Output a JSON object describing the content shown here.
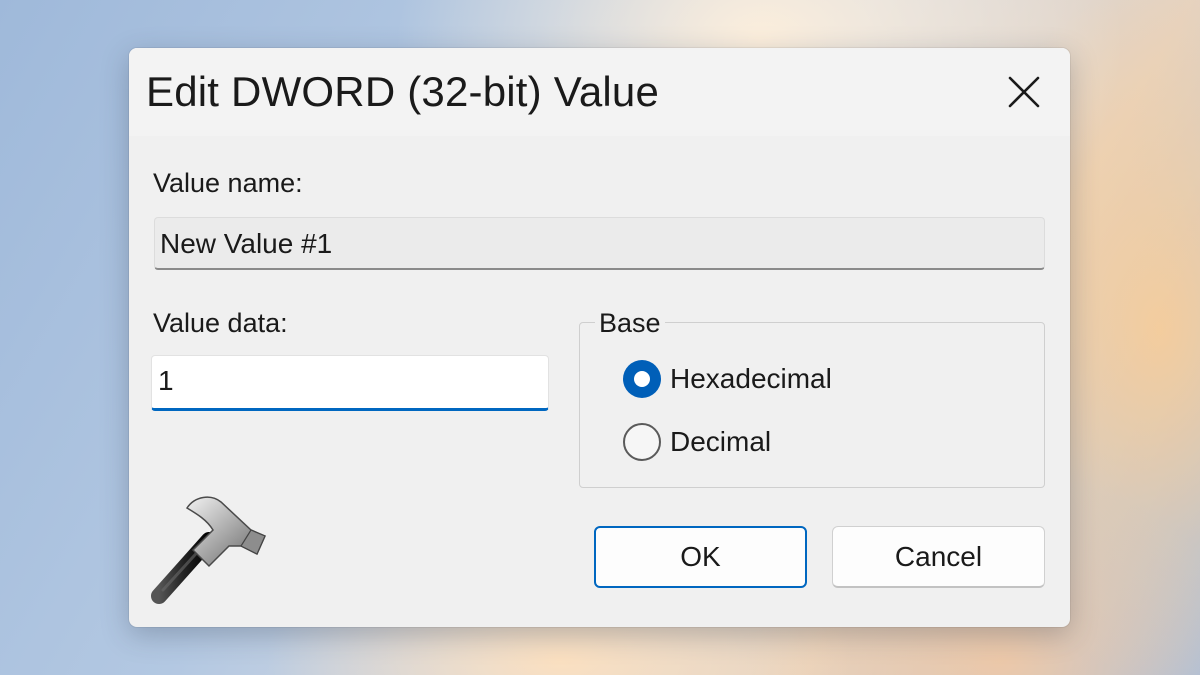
{
  "dialog": {
    "title": "Edit DWORD (32-bit) Value",
    "close_icon": "close-icon",
    "value_name_label": "Value name:",
    "value_name": "New Value #1",
    "value_data_label": "Value data:",
    "value_data": "1",
    "base": {
      "legend": "Base",
      "options": [
        {
          "label": "Hexadecimal",
          "checked": true
        },
        {
          "label": "Decimal",
          "checked": false
        }
      ]
    },
    "app_icon": "hammer-icon",
    "ok_label": "OK",
    "cancel_label": "Cancel",
    "accent_color": "#0067c0"
  }
}
